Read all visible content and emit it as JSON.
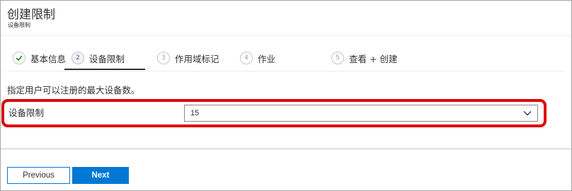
{
  "header": {
    "title": "创建限制",
    "subtitle": "设备限制"
  },
  "steps": [
    {
      "number": "",
      "label": "基本信息",
      "state": "completed",
      "icon": "checkmark-icon"
    },
    {
      "number": "2",
      "label": "设备限制",
      "state": "current"
    },
    {
      "number": "3",
      "label": "作用域标记",
      "state": "pending"
    },
    {
      "number": "4",
      "label": "作业",
      "state": "pending"
    },
    {
      "number": "5",
      "label": "查看 + 创建",
      "state": "pending"
    }
  ],
  "main": {
    "description": "指定用户可以注册的最大设备数。",
    "device_limit_label": "设备限制",
    "device_limit_value": "15",
    "dropdown_icon": "chevron-down-icon"
  },
  "footer": {
    "previous_label": "Previous",
    "next_label": "Next"
  },
  "colors": {
    "accent": "#0078d4",
    "highlight": "#e00000",
    "check": "#107c10"
  }
}
